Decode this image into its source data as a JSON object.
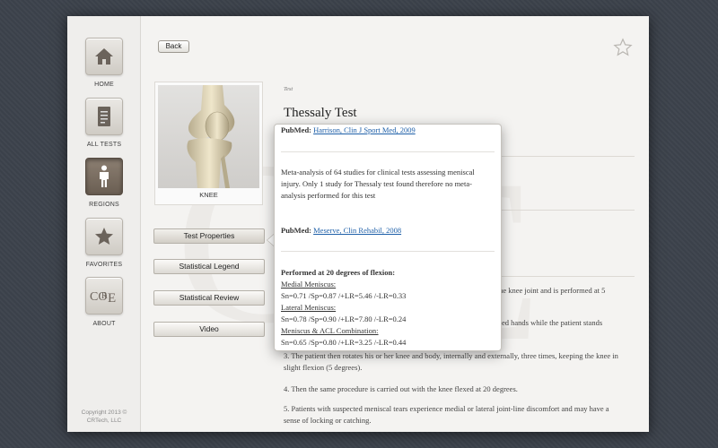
{
  "sidebar": {
    "items": [
      {
        "label": "HOME",
        "icon": "home-icon"
      },
      {
        "label": "ALL TESTS",
        "icon": "document-icon"
      },
      {
        "label": "REGIONS",
        "icon": "person-icon"
      },
      {
        "label": "FAVORITES",
        "icon": "star-icon"
      },
      {
        "label": "ABOUT",
        "icon": "core-logo-icon"
      }
    ],
    "active": "REGIONS",
    "copyright_line1": "Copyright 2013 ©",
    "copyright_line2": "CRTech, LLC"
  },
  "toolbar": {
    "back_label": "Back"
  },
  "region": {
    "label": "KNEE"
  },
  "side_buttons": [
    {
      "label": "Test Properties"
    },
    {
      "label": "Statistical Legend"
    },
    {
      "label": "Statistical Review"
    },
    {
      "label": "Video"
    }
  ],
  "test": {
    "section_label": "Test",
    "title": "Thessaly Test",
    "lines": [
      "in the knee joint and is performed at 5",
      "ed hands while the patient stands",
      "3. The patient then rotates his or her knee and body, internally and externally, three times, keeping the knee in",
      "slight flexion (5 degrees).",
      "4. Then the same procedure is carried out with the knee flexed at 20 degrees.",
      "5. Patients with suspected meniscal tears experience medial or lateral joint-line discomfort and may have a",
      "sense of locking or catching."
    ]
  },
  "popover": {
    "pubmed_label": "PubMed:",
    "ref1": "Harrison, Clin J Sport Med, 2009",
    "summary_line1": "Meta-analysis of 64 studies for clinical tests assessing meniscal",
    "summary_line2": "injury. Only 1 study for Thessaly test found therefore no meta-",
    "summary_line3": "analysis performed for this test",
    "ref2": "Meserve, Clin Rehabil, 2008",
    "heading": "Performed at 20 degrees of flexion:",
    "medial_label": "Medial Meniscus:",
    "medial_stats": "Sn=0.71 /Sp=0.87 /+LR=5.46 /-LR=0.33",
    "lateral_label": "Lateral Meniscus:",
    "lateral_stats": "Sn=0.78 /Sp=0.90 /+LR=7.80 /-LR=0.24",
    "combo_label": "Meniscus & ACL Combination:",
    "combo_stats": "Sn=0.65 /Sp=0.80 /+LR=3.25 /-LR=0.44"
  },
  "colors": {
    "background": "#3d434c",
    "window": "#f4f3f1",
    "active_tile": "#6f6357",
    "link": "#1d5fa8"
  }
}
